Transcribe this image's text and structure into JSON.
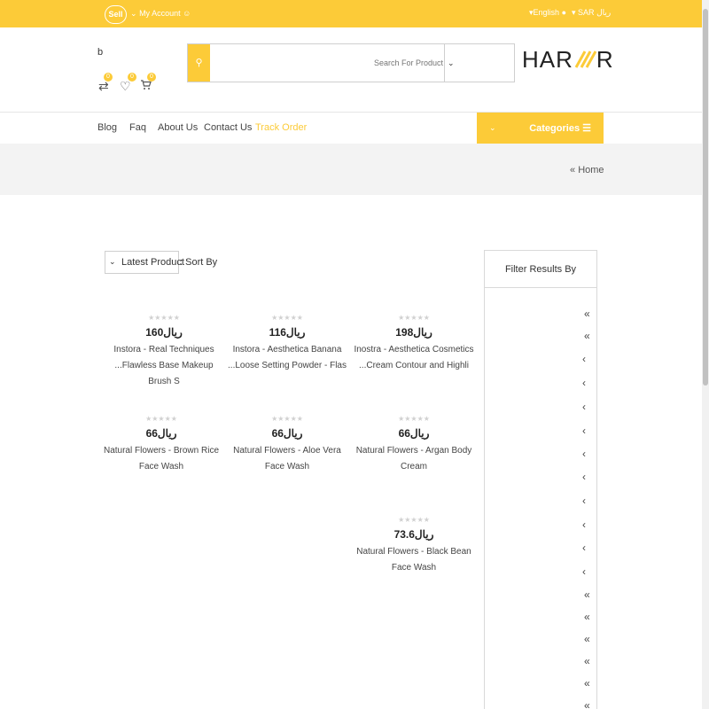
{
  "topbar": {
    "sell": "Sell",
    "my_account": "My Account",
    "language": "English",
    "currency": "SAR ريال"
  },
  "header": {
    "user_initial": "b",
    "compare_count": "0",
    "wishlist_count": "0",
    "cart_count": "0",
    "search_placeholder": "Search For Product",
    "logo_left": "HAR",
    "logo_right": "R"
  },
  "nav": {
    "items": [
      "Blog",
      "Faq",
      "About Us",
      "Contact Us",
      "Track Order"
    ],
    "categories": "Categories"
  },
  "breadcrumb": {
    "home": "Home"
  },
  "sort": {
    "label": ": Sort By",
    "value": "Latest Product"
  },
  "filter": {
    "title": "Filter Results By"
  },
  "currency_symbol": "ريال",
  "products": [
    {
      "price": "160ريال",
      "line1": "Instora - Real Techniques",
      "line2": "...Flawless Base Makeup Brush S"
    },
    {
      "price": "116ريال",
      "line1": "Instora - Aesthetica Banana",
      "line2": "...Loose Setting Powder - Flas"
    },
    {
      "price": "198ريال",
      "line1": "Inostra - Aesthetica Cosmetics",
      "line2": "...Cream Contour and Highli"
    },
    {
      "price": "66ريال",
      "line1": "Natural Flowers - Brown Rice",
      "line2": "Face Wash"
    },
    {
      "price": "66ريال",
      "line1": "Natural Flowers - Aloe Vera",
      "line2": "Face Wash"
    },
    {
      "price": "66ريال",
      "line1": "Natural Flowers - Argan Body",
      "line2": "Cream"
    },
    {
      "price": "73.6ريال",
      "line1": "Natural Flowers - Black Bean",
      "line2": "Face Wash"
    }
  ],
  "colors": {
    "accent": "#fccb38",
    "active_nav": "#fccb38"
  }
}
